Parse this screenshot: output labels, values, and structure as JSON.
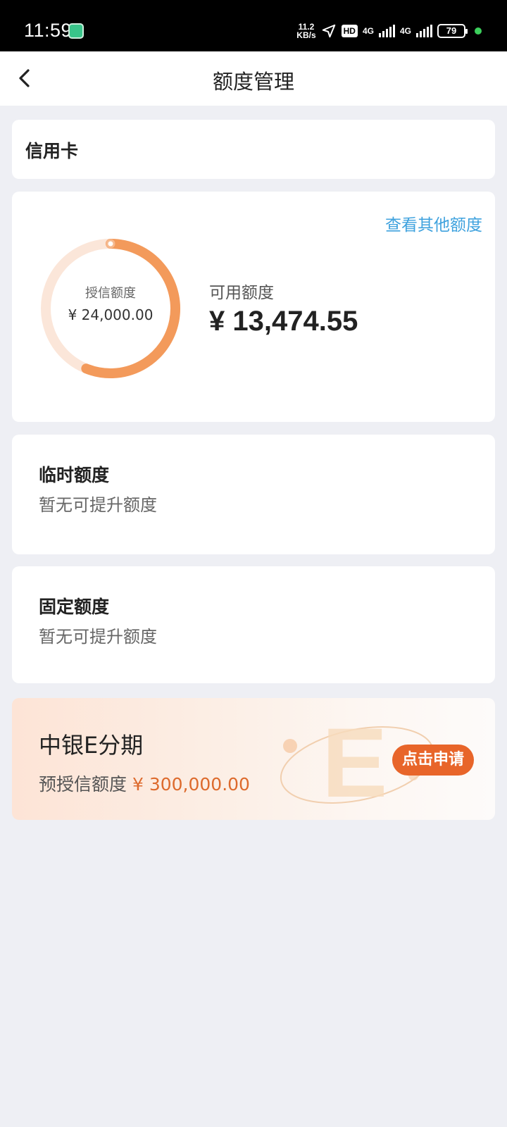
{
  "status_bar": {
    "time": "11:59",
    "net_speed_value": "11.2",
    "net_speed_unit": "KB/s",
    "hd_label": "HD",
    "network_1": "4G",
    "network_2": "4G",
    "battery": "79"
  },
  "nav": {
    "title": "额度管理"
  },
  "card_type": {
    "label": "信用卡"
  },
  "limit": {
    "other_link": "查看其他额度",
    "credit_label": "授信额度",
    "credit_value": "¥ 24,000.00",
    "available_label": "可用额度",
    "available_value": "¥ 13,474.55",
    "available_fraction": 0.5614
  },
  "temporary": {
    "title": "临时额度",
    "subtitle": "暂无可提升额度"
  },
  "fixed": {
    "title": "固定额度",
    "subtitle": "暂无可提升额度"
  },
  "promo": {
    "title": "中银E分期",
    "subtitle_prefix": "预授信额度",
    "amount": "¥ 300,000.00",
    "button_label": "点击申请"
  },
  "colors": {
    "accent_orange": "#e8652a",
    "link_blue": "#3fa2de",
    "ring_fill": "#f39a5b",
    "ring_track": "#fbe3d4"
  }
}
